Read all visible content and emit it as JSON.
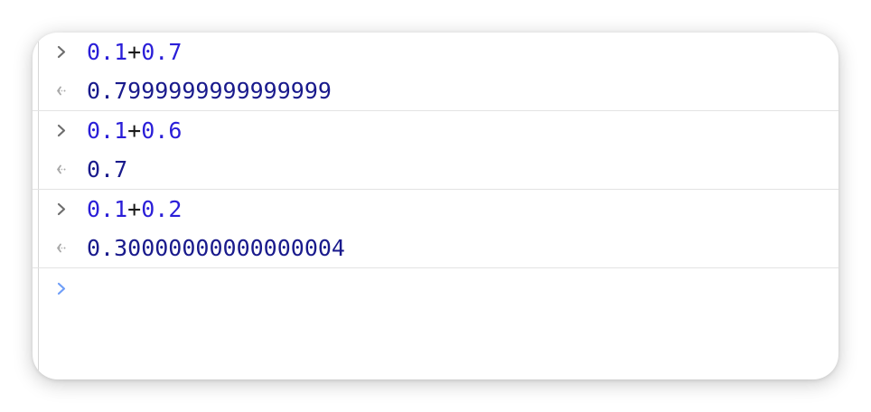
{
  "console": {
    "entries": [
      {
        "input": {
          "left": "0.1",
          "operator": "+",
          "right": "0.7"
        },
        "output": "0.7999999999999999"
      },
      {
        "input": {
          "left": "0.1",
          "operator": "+",
          "right": "0.6"
        },
        "output": "0.7"
      },
      {
        "input": {
          "left": "0.1",
          "operator": "+",
          "right": "0.2"
        },
        "output": "0.30000000000000004"
      }
    ],
    "icons": {
      "input_marker": "chevron-right-icon",
      "output_marker": "return-arrow-icon",
      "prompt_marker": "chevron-right-icon"
    },
    "colors": {
      "number": "#2a1ed8",
      "result": "#191a8c",
      "input_marker": "#6e6e6e",
      "output_marker": "#a8a8a8",
      "prompt_marker": "#6f9ef8"
    }
  }
}
